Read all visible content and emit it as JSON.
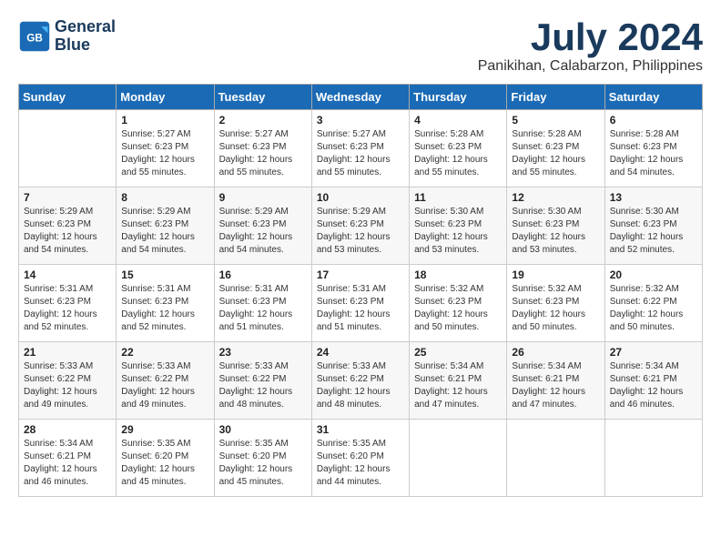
{
  "header": {
    "logo_line1": "General",
    "logo_line2": "Blue",
    "month_year": "July 2024",
    "location": "Panikihan, Calabarzon, Philippines"
  },
  "weekdays": [
    "Sunday",
    "Monday",
    "Tuesday",
    "Wednesday",
    "Thursday",
    "Friday",
    "Saturday"
  ],
  "weeks": [
    [
      {
        "day": "",
        "info": ""
      },
      {
        "day": "1",
        "info": "Sunrise: 5:27 AM\nSunset: 6:23 PM\nDaylight: 12 hours\nand 55 minutes."
      },
      {
        "day": "2",
        "info": "Sunrise: 5:27 AM\nSunset: 6:23 PM\nDaylight: 12 hours\nand 55 minutes."
      },
      {
        "day": "3",
        "info": "Sunrise: 5:27 AM\nSunset: 6:23 PM\nDaylight: 12 hours\nand 55 minutes."
      },
      {
        "day": "4",
        "info": "Sunrise: 5:28 AM\nSunset: 6:23 PM\nDaylight: 12 hours\nand 55 minutes."
      },
      {
        "day": "5",
        "info": "Sunrise: 5:28 AM\nSunset: 6:23 PM\nDaylight: 12 hours\nand 55 minutes."
      },
      {
        "day": "6",
        "info": "Sunrise: 5:28 AM\nSunset: 6:23 PM\nDaylight: 12 hours\nand 54 minutes."
      }
    ],
    [
      {
        "day": "7",
        "info": "Sunrise: 5:29 AM\nSunset: 6:23 PM\nDaylight: 12 hours\nand 54 minutes."
      },
      {
        "day": "8",
        "info": "Sunrise: 5:29 AM\nSunset: 6:23 PM\nDaylight: 12 hours\nand 54 minutes."
      },
      {
        "day": "9",
        "info": "Sunrise: 5:29 AM\nSunset: 6:23 PM\nDaylight: 12 hours\nand 54 minutes."
      },
      {
        "day": "10",
        "info": "Sunrise: 5:29 AM\nSunset: 6:23 PM\nDaylight: 12 hours\nand 53 minutes."
      },
      {
        "day": "11",
        "info": "Sunrise: 5:30 AM\nSunset: 6:23 PM\nDaylight: 12 hours\nand 53 minutes."
      },
      {
        "day": "12",
        "info": "Sunrise: 5:30 AM\nSunset: 6:23 PM\nDaylight: 12 hours\nand 53 minutes."
      },
      {
        "day": "13",
        "info": "Sunrise: 5:30 AM\nSunset: 6:23 PM\nDaylight: 12 hours\nand 52 minutes."
      }
    ],
    [
      {
        "day": "14",
        "info": "Sunrise: 5:31 AM\nSunset: 6:23 PM\nDaylight: 12 hours\nand 52 minutes."
      },
      {
        "day": "15",
        "info": "Sunrise: 5:31 AM\nSunset: 6:23 PM\nDaylight: 12 hours\nand 52 minutes."
      },
      {
        "day": "16",
        "info": "Sunrise: 5:31 AM\nSunset: 6:23 PM\nDaylight: 12 hours\nand 51 minutes."
      },
      {
        "day": "17",
        "info": "Sunrise: 5:31 AM\nSunset: 6:23 PM\nDaylight: 12 hours\nand 51 minutes."
      },
      {
        "day": "18",
        "info": "Sunrise: 5:32 AM\nSunset: 6:23 PM\nDaylight: 12 hours\nand 50 minutes."
      },
      {
        "day": "19",
        "info": "Sunrise: 5:32 AM\nSunset: 6:23 PM\nDaylight: 12 hours\nand 50 minutes."
      },
      {
        "day": "20",
        "info": "Sunrise: 5:32 AM\nSunset: 6:22 PM\nDaylight: 12 hours\nand 50 minutes."
      }
    ],
    [
      {
        "day": "21",
        "info": "Sunrise: 5:33 AM\nSunset: 6:22 PM\nDaylight: 12 hours\nand 49 minutes."
      },
      {
        "day": "22",
        "info": "Sunrise: 5:33 AM\nSunset: 6:22 PM\nDaylight: 12 hours\nand 49 minutes."
      },
      {
        "day": "23",
        "info": "Sunrise: 5:33 AM\nSunset: 6:22 PM\nDaylight: 12 hours\nand 48 minutes."
      },
      {
        "day": "24",
        "info": "Sunrise: 5:33 AM\nSunset: 6:22 PM\nDaylight: 12 hours\nand 48 minutes."
      },
      {
        "day": "25",
        "info": "Sunrise: 5:34 AM\nSunset: 6:21 PM\nDaylight: 12 hours\nand 47 minutes."
      },
      {
        "day": "26",
        "info": "Sunrise: 5:34 AM\nSunset: 6:21 PM\nDaylight: 12 hours\nand 47 minutes."
      },
      {
        "day": "27",
        "info": "Sunrise: 5:34 AM\nSunset: 6:21 PM\nDaylight: 12 hours\nand 46 minutes."
      }
    ],
    [
      {
        "day": "28",
        "info": "Sunrise: 5:34 AM\nSunset: 6:21 PM\nDaylight: 12 hours\nand 46 minutes."
      },
      {
        "day": "29",
        "info": "Sunrise: 5:35 AM\nSunset: 6:20 PM\nDaylight: 12 hours\nand 45 minutes."
      },
      {
        "day": "30",
        "info": "Sunrise: 5:35 AM\nSunset: 6:20 PM\nDaylight: 12 hours\nand 45 minutes."
      },
      {
        "day": "31",
        "info": "Sunrise: 5:35 AM\nSunset: 6:20 PM\nDaylight: 12 hours\nand 44 minutes."
      },
      {
        "day": "",
        "info": ""
      },
      {
        "day": "",
        "info": ""
      },
      {
        "day": "",
        "info": ""
      }
    ]
  ]
}
